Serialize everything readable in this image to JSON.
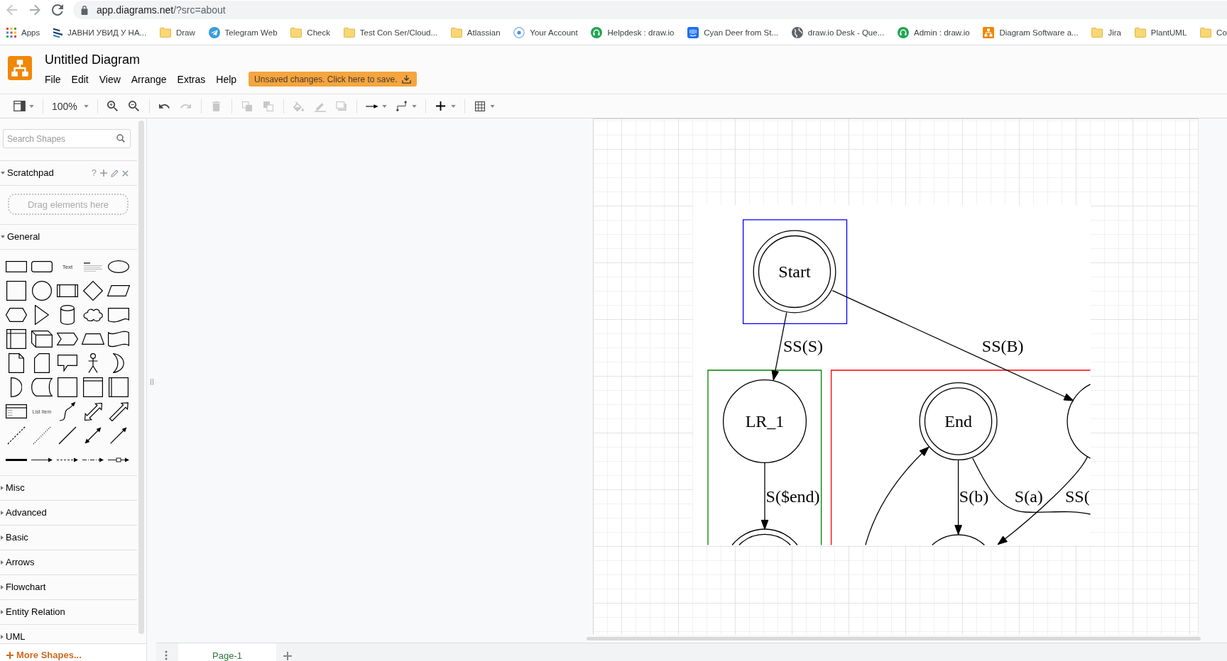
{
  "browser": {
    "url_host": "app.diagrams.net",
    "url_path": "/?src=about",
    "bookmarks": [
      {
        "label": "Apps",
        "kind": "apps"
      },
      {
        "label": "ЈАВНИ УВИД У НА...",
        "kind": "chevrons"
      },
      {
        "label": "Draw",
        "kind": "folder"
      },
      {
        "label": "Telegram Web",
        "kind": "telegram"
      },
      {
        "label": "Check",
        "kind": "folder"
      },
      {
        "label": "Test Con Ser/Cloud...",
        "kind": "folder"
      },
      {
        "label": "Atlassian",
        "kind": "folder"
      },
      {
        "label": "Your Account",
        "kind": "ring"
      },
      {
        "label": "Helpdesk : draw.io",
        "kind": "headset"
      },
      {
        "label": "Cyan Deer from St...",
        "kind": "chat"
      },
      {
        "label": "draw.io Desk - Que...",
        "kind": "globe"
      },
      {
        "label": "Admin : draw.io",
        "kind": "headset"
      },
      {
        "label": "Diagram Software a...",
        "kind": "drawio"
      },
      {
        "label": "Jira",
        "kind": "folder"
      },
      {
        "label": "PlantUML",
        "kind": "folder"
      },
      {
        "label": "Co",
        "kind": "folder"
      }
    ]
  },
  "app": {
    "title": "Untitled Diagram",
    "menu": [
      "File",
      "Edit",
      "View",
      "Arrange",
      "Extras",
      "Help"
    ],
    "save_notice": "Unsaved changes. Click here to save."
  },
  "toolbar": [
    {
      "kind": "panel",
      "disabled": false,
      "dropdown": true
    },
    {
      "kind": "separator"
    },
    {
      "kind": "zoom",
      "label": "100%",
      "disabled": false,
      "dropdown": true
    },
    {
      "kind": "separator"
    },
    {
      "kind": "zoom-in",
      "disabled": false,
      "dropdown": false
    },
    {
      "kind": "zoom-out",
      "disabled": false,
      "dropdown": false
    },
    {
      "kind": "separator"
    },
    {
      "kind": "undo",
      "disabled": false,
      "dropdown": false
    },
    {
      "kind": "redo",
      "disabled": true,
      "dropdown": false
    },
    {
      "kind": "separator"
    },
    {
      "kind": "delete",
      "disabled": true,
      "dropdown": false
    },
    {
      "kind": "separator"
    },
    {
      "kind": "to-front",
      "disabled": true,
      "dropdown": false
    },
    {
      "kind": "to-back",
      "disabled": true,
      "dropdown": false
    },
    {
      "kind": "separator"
    },
    {
      "kind": "fill-color",
      "disabled": true,
      "dropdown": false
    },
    {
      "kind": "line-color",
      "disabled": true,
      "dropdown": false
    },
    {
      "kind": "shadow",
      "disabled": true,
      "dropdown": false
    },
    {
      "kind": "separator"
    },
    {
      "kind": "connection",
      "disabled": false,
      "dropdown": true
    },
    {
      "kind": "waypoints",
      "disabled": false,
      "dropdown": true
    },
    {
      "kind": "separator"
    },
    {
      "kind": "insert",
      "disabled": false,
      "dropdown": true
    },
    {
      "kind": "separator"
    },
    {
      "kind": "table",
      "disabled": false,
      "dropdown": true
    }
  ],
  "sidebar": {
    "search": {
      "placeholder": "Search Shapes"
    },
    "scratchpad": {
      "title": "Scratchpad",
      "help": "?",
      "expanded": true,
      "hint": "Drag elements here"
    },
    "sections": [
      {
        "title": "General",
        "expanded": true,
        "shapes": [
          {
            "kind": "rectangle"
          },
          {
            "kind": "rounded-rectangle"
          },
          {
            "kind": "text",
            "label": "Text"
          },
          {
            "kind": "textbox"
          },
          {
            "kind": "ellipse"
          },
          {
            "kind": "square"
          },
          {
            "kind": "circle"
          },
          {
            "kind": "process"
          },
          {
            "kind": "diamond"
          },
          {
            "kind": "parallelogram"
          },
          {
            "kind": "hexagon"
          },
          {
            "kind": "triangle"
          },
          {
            "kind": "cylinder"
          },
          {
            "kind": "cloud"
          },
          {
            "kind": "document"
          },
          {
            "kind": "internal-storage"
          },
          {
            "kind": "cube"
          },
          {
            "kind": "step"
          },
          {
            "kind": "trapezoid"
          },
          {
            "kind": "tape"
          },
          {
            "kind": "note"
          },
          {
            "kind": "card"
          },
          {
            "kind": "callout"
          },
          {
            "kind": "actor"
          },
          {
            "kind": "or"
          },
          {
            "kind": "delay"
          },
          {
            "kind": "data-storage"
          },
          {
            "kind": "container"
          },
          {
            "kind": "swimlane"
          },
          {
            "kind": "vertical-container"
          },
          {
            "kind": "list"
          },
          {
            "kind": "list-item",
            "label": "List Item"
          },
          {
            "kind": "curved-arrow"
          },
          {
            "kind": "double-block-arrow"
          },
          {
            "kind": "block-arrow"
          },
          {
            "kind": "dashed-line"
          },
          {
            "kind": "dotted-line"
          },
          {
            "kind": "line"
          },
          {
            "kind": "double-arrow-line"
          },
          {
            "kind": "arrow-line"
          },
          {
            "kind": "thick-line"
          },
          {
            "kind": "connector"
          },
          {
            "kind": "dashed-connector"
          },
          {
            "kind": "long-dashed-connector"
          },
          {
            "kind": "symbol-connector"
          }
        ]
      },
      {
        "title": "Misc",
        "expanded": false
      },
      {
        "title": "Advanced",
        "expanded": false
      },
      {
        "title": "Basic",
        "expanded": false
      },
      {
        "title": "Arrows",
        "expanded": false
      },
      {
        "title": "Flowchart",
        "expanded": false
      },
      {
        "title": "Entity Relation",
        "expanded": false
      },
      {
        "title": "UML",
        "expanded": false
      }
    ],
    "more_shapes": "More Shapes..."
  },
  "diagram": {
    "clusters": [
      {
        "color": "#0000ff"
      },
      {
        "color": "#008000"
      },
      {
        "color": "#ff0000"
      }
    ],
    "nodes": [
      {
        "kind": "double",
        "label": "Start"
      },
      {
        "kind": "single",
        "label": "LR_1"
      },
      {
        "kind": "double",
        "label": "End"
      },
      {
        "kind": "single"
      },
      {
        "kind": "double"
      },
      {
        "kind": "single"
      }
    ],
    "edges": [
      {
        "kind": "arrow",
        "label": "SS(S)"
      },
      {
        "kind": "arrow",
        "label": "SS(B)"
      },
      {
        "kind": "arrow",
        "label": "S($end)"
      },
      {
        "kind": "arrow",
        "label": "S(b)"
      },
      {
        "kind": "line",
        "label": "S(a)"
      },
      {
        "kind": "arrow",
        "label": "SS("
      },
      {
        "kind": "arrow"
      }
    ]
  },
  "pages": [
    {
      "label": "Page-1",
      "selected": true
    }
  ]
}
